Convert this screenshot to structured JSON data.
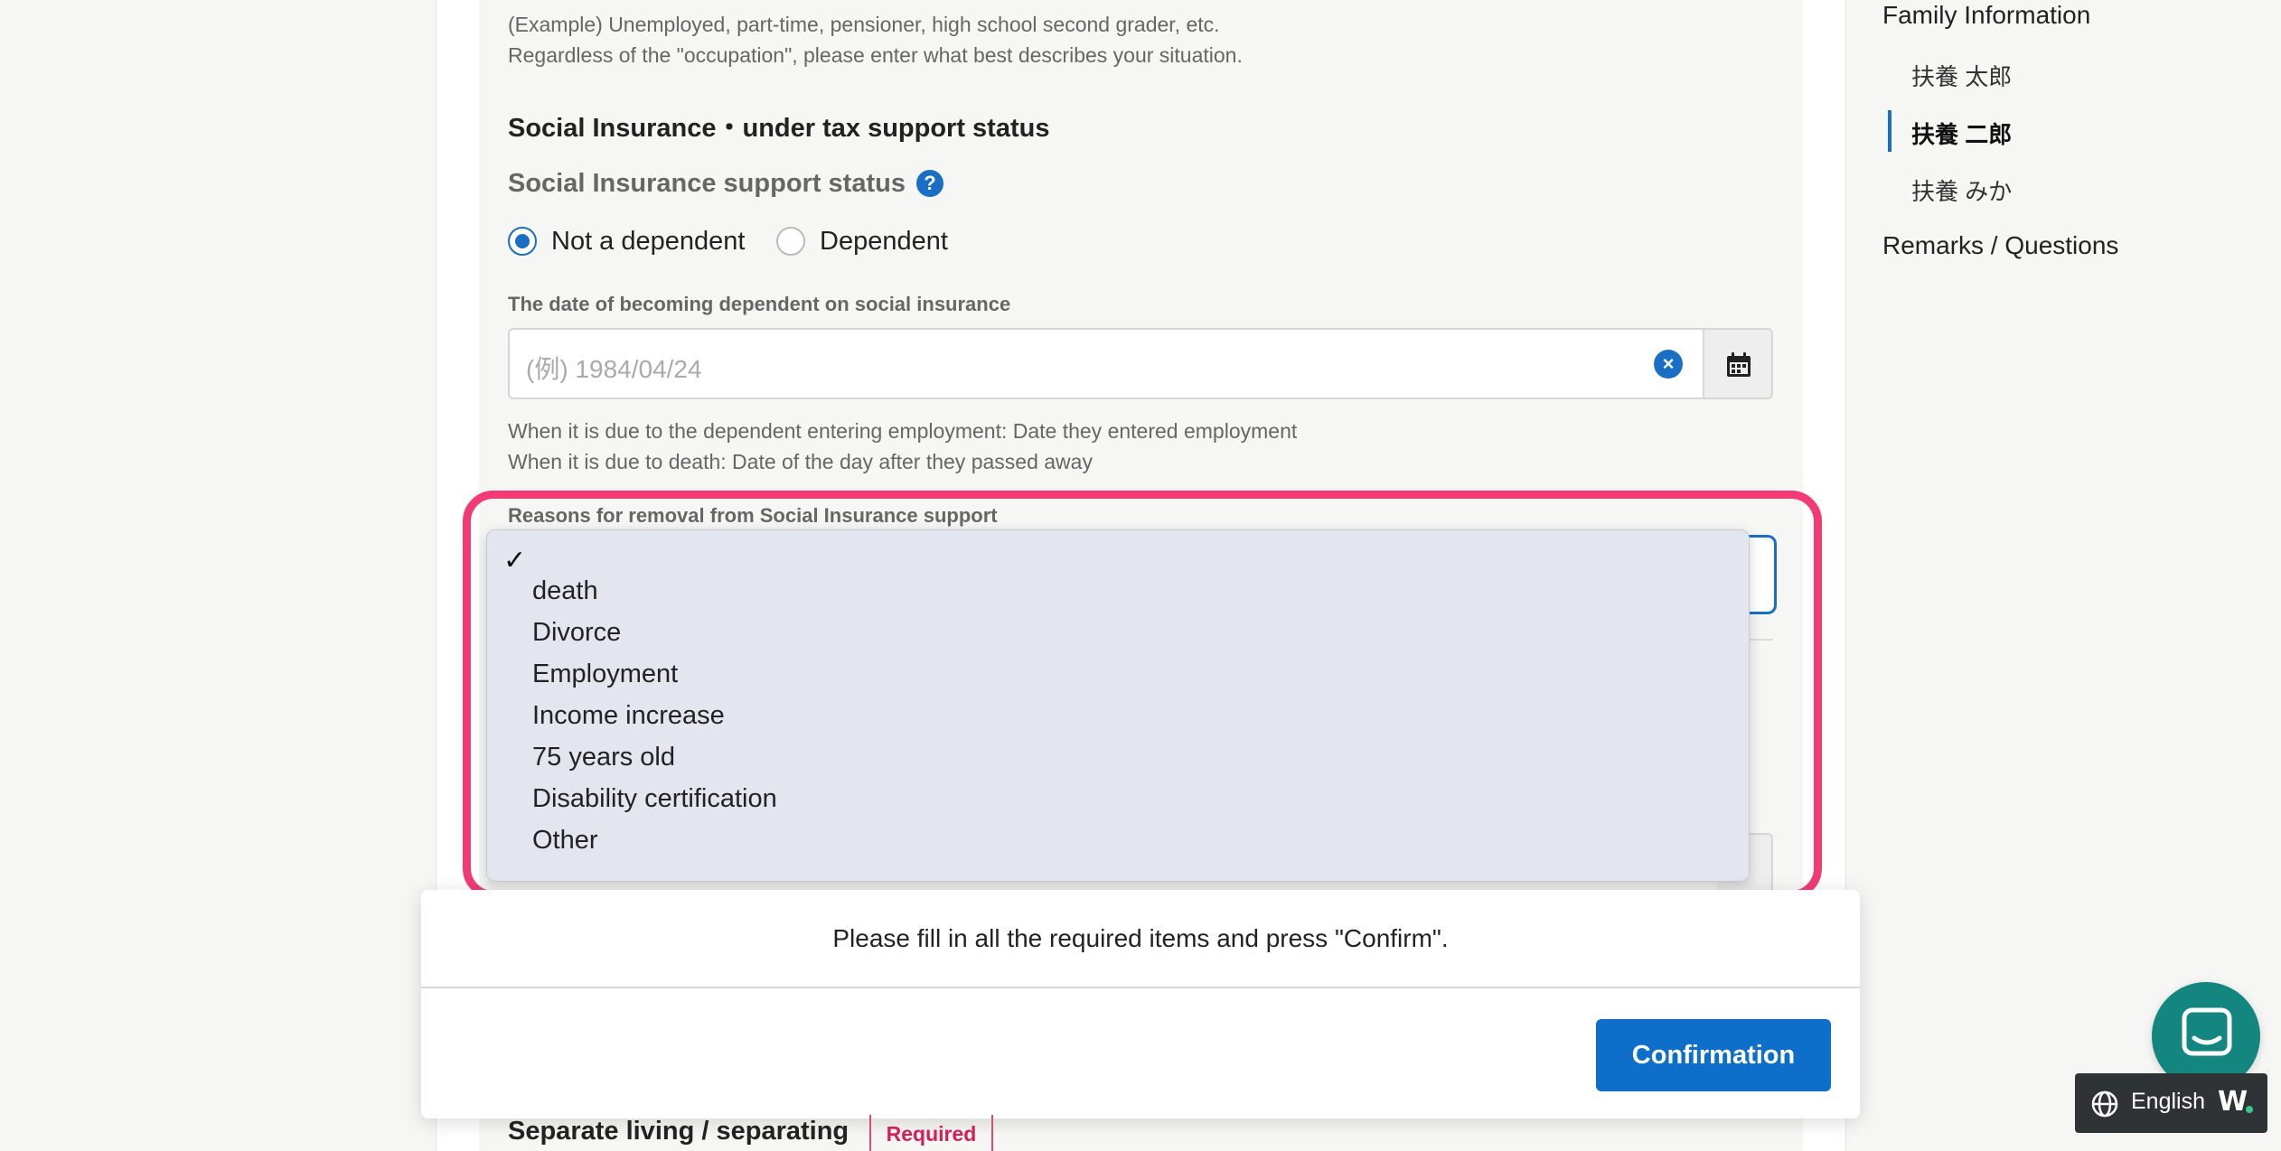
{
  "form": {
    "occupation_hint_1": "(Example) Unemployed, part-time, pensioner, high school second grader, etc.",
    "occupation_hint_2": "Regardless of the \"occupation\", please enter what best describes your situation.",
    "section_title": "Social Insurance・under tax support status",
    "support_status_label": "Social Insurance support status",
    "help_icon_glyph": "?",
    "radio_not_dependent": "Not a dependent",
    "radio_dependent": "Dependent",
    "selected_status": "Not a dependent",
    "date_label": "The date of becoming dependent on social insurance",
    "date_placeholder": "(例) 1984/04/24",
    "date_note_1": "When it is due to the dependent entering employment: Date they entered employment",
    "date_note_2": "When it is due to death: Date of the day after they passed away",
    "removal_label": "Reasons for removal from Social Insurance support",
    "separate_living_label": "Separate living / separating",
    "required_badge": "Required"
  },
  "dropdown": {
    "selected_index": 0,
    "check_glyph": "✓",
    "options": [
      "",
      "death",
      "Divorce",
      "Employment",
      "Income increase",
      "75 years old",
      "Disability certification",
      "Other"
    ]
  },
  "modal": {
    "message": "Please fill in all the required items and press \"Confirm\".",
    "confirm_label": "Confirmation"
  },
  "nav": {
    "family_information": "Family Information",
    "members": [
      "扶養 太郎",
      "扶養 二郎",
      "扶養 みか"
    ],
    "active_member": "扶養 二郎",
    "remarks": "Remarks / Questions"
  },
  "language": {
    "label": "English",
    "logo": "W"
  },
  "colors": {
    "accent": "#1a6fc4",
    "highlight": "#f23a75",
    "required": "#d21f57",
    "chat": "#13867f"
  }
}
